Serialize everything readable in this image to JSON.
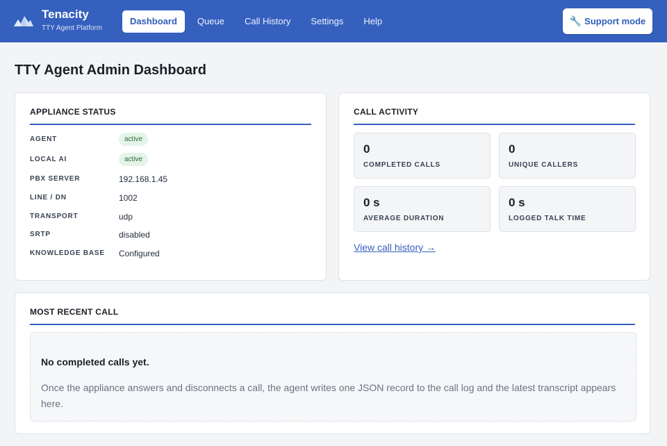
{
  "header": {
    "brand_name": "Tenacity",
    "brand_subtitle": "TTY Agent Platform",
    "logo_icon": "mountain-logo-icon",
    "nav": [
      {
        "label": "Dashboard",
        "active": true
      },
      {
        "label": "Queue",
        "active": false
      },
      {
        "label": "Call History",
        "active": false
      },
      {
        "label": "Settings",
        "active": false
      },
      {
        "label": "Help",
        "active": false
      }
    ],
    "support_icon": "wrench-icon",
    "support_label": "Support mode",
    "bg_color": "#3560be"
  },
  "page_title": "TTY Agent Admin Dashboard",
  "appliance": {
    "title": "APPLIANCE STATUS",
    "rows": [
      {
        "label": "AGENT",
        "value": "active",
        "badge": true
      },
      {
        "label": "LOCAL AI",
        "value": "active",
        "badge": true
      },
      {
        "label": "PBX SERVER",
        "value": "192.168.1.45"
      },
      {
        "label": "LINE / DN",
        "value": "1002"
      },
      {
        "label": "TRANSPORT",
        "value": "udp"
      },
      {
        "label": "SRTP",
        "value": "disabled"
      },
      {
        "label": "KNOWLEDGE BASE",
        "value": "Configured"
      }
    ]
  },
  "activity": {
    "title": "CALL ACTIVITY",
    "stats": [
      {
        "value": "0",
        "label": "COMPLETED CALLS"
      },
      {
        "value": "0",
        "label": "UNIQUE CALLERS"
      },
      {
        "value": "0 s",
        "label": "AVERAGE DURATION"
      },
      {
        "value": "0 s",
        "label": "LOGGED TALK TIME"
      }
    ],
    "link_label": "View call history →"
  },
  "recent": {
    "title": "MOST RECENT CALL",
    "empty_title": "No completed calls yet.",
    "empty_text": "Once the appliance answers and disconnects a call, the agent writes one JSON record to the call log and the latest transcript appears here."
  }
}
